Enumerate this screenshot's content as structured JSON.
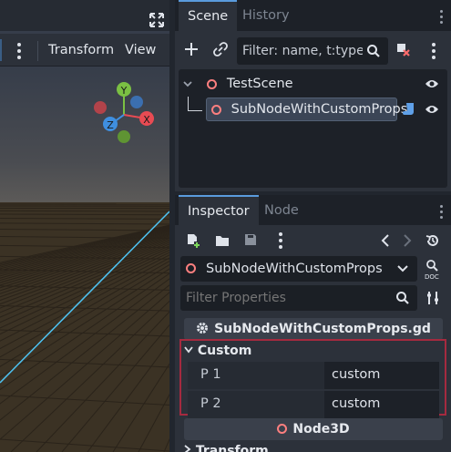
{
  "viewport": {
    "toolbar": {
      "transform_label": "Transform",
      "view_label": "View"
    },
    "gizmo": {
      "y_label": "Y",
      "x_label": "X",
      "z_label": "Z"
    },
    "colors": {
      "sky": "#363d4a",
      "ground": "#3b3224",
      "horizon": "#5c5a58",
      "axis_line": "#4ec3f2"
    }
  },
  "scene_dock": {
    "tabs": [
      {
        "label": "Scene"
      },
      {
        "label": "History"
      }
    ],
    "filter_placeholder": "Filter: name, t:type,",
    "tree": {
      "root": {
        "label": "TestScene",
        "icon": "node-ring-icon"
      },
      "child": {
        "label": "SubNodeWithCustomProps",
        "icon": "node-ring-icon",
        "script_icon": "script-icon"
      }
    }
  },
  "inspector": {
    "tabs": [
      {
        "label": "Inspector"
      },
      {
        "label": "Node"
      }
    ],
    "selected_node": "SubNodeWithCustomProps",
    "filter_placeholder": "Filter Properties",
    "script_header": "SubNodeWithCustomProps.gd",
    "group_label": "Custom",
    "properties": [
      {
        "name": "P 1",
        "value": "custom"
      },
      {
        "name": "P 2",
        "value": "custom"
      }
    ],
    "class_header": "Node3D",
    "next_group": "Transform"
  },
  "colors": {
    "accent": "#5a9bdd",
    "node_icon": "#fc7f7f",
    "highlight_border": "#a52a3f"
  }
}
